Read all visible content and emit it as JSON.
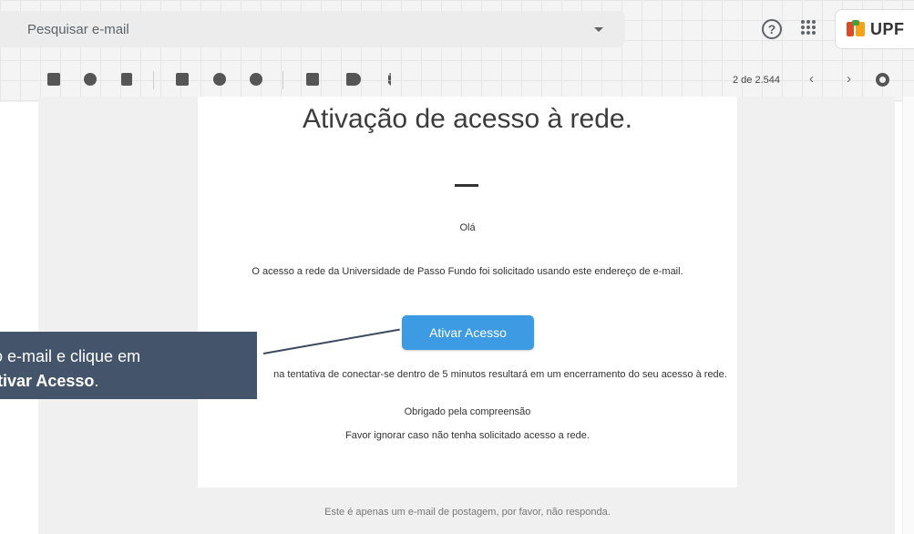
{
  "search": {
    "placeholder": "Pesquisar e-mail"
  },
  "header": {
    "help_icon": "?",
    "brand_name": "UPF"
  },
  "toolbar": {
    "count": "2 de 2.544",
    "prev": "‹",
    "next": "›",
    "icons": [
      "archive-icon",
      "report-spam-icon",
      "delete-icon",
      "mark-unread-icon",
      "snooze-icon",
      "add-task-icon",
      "move-to-icon",
      "label-icon",
      "more-icon",
      "settings-icon"
    ]
  },
  "email": {
    "heading": "Ativação de acesso à rede.",
    "greeting": "Olá",
    "info": "O acesso a rede da Universidade de Passo Fundo foi solicitado usando este endereço de e-mail.",
    "button": "Ativar Acesso",
    "warning": "na tentativa de conectar-se dentro de 5 minutos resultará em um encerramento do seu acesso à rede.",
    "thanks": "Obrigado pela compreensão",
    "ignore": "Favor ignorar caso não tenha solicitado acesso a rede.",
    "footer": "Este é apenas um e-mail de postagem, por favor, não responda."
  },
  "callout": {
    "line1": "o e-mail e clique em",
    "line2_bold": "tivar Acesso",
    "line2_tail": "."
  },
  "colors": {
    "callout_bg": "#44546a",
    "button_bg": "#3d9be4"
  }
}
